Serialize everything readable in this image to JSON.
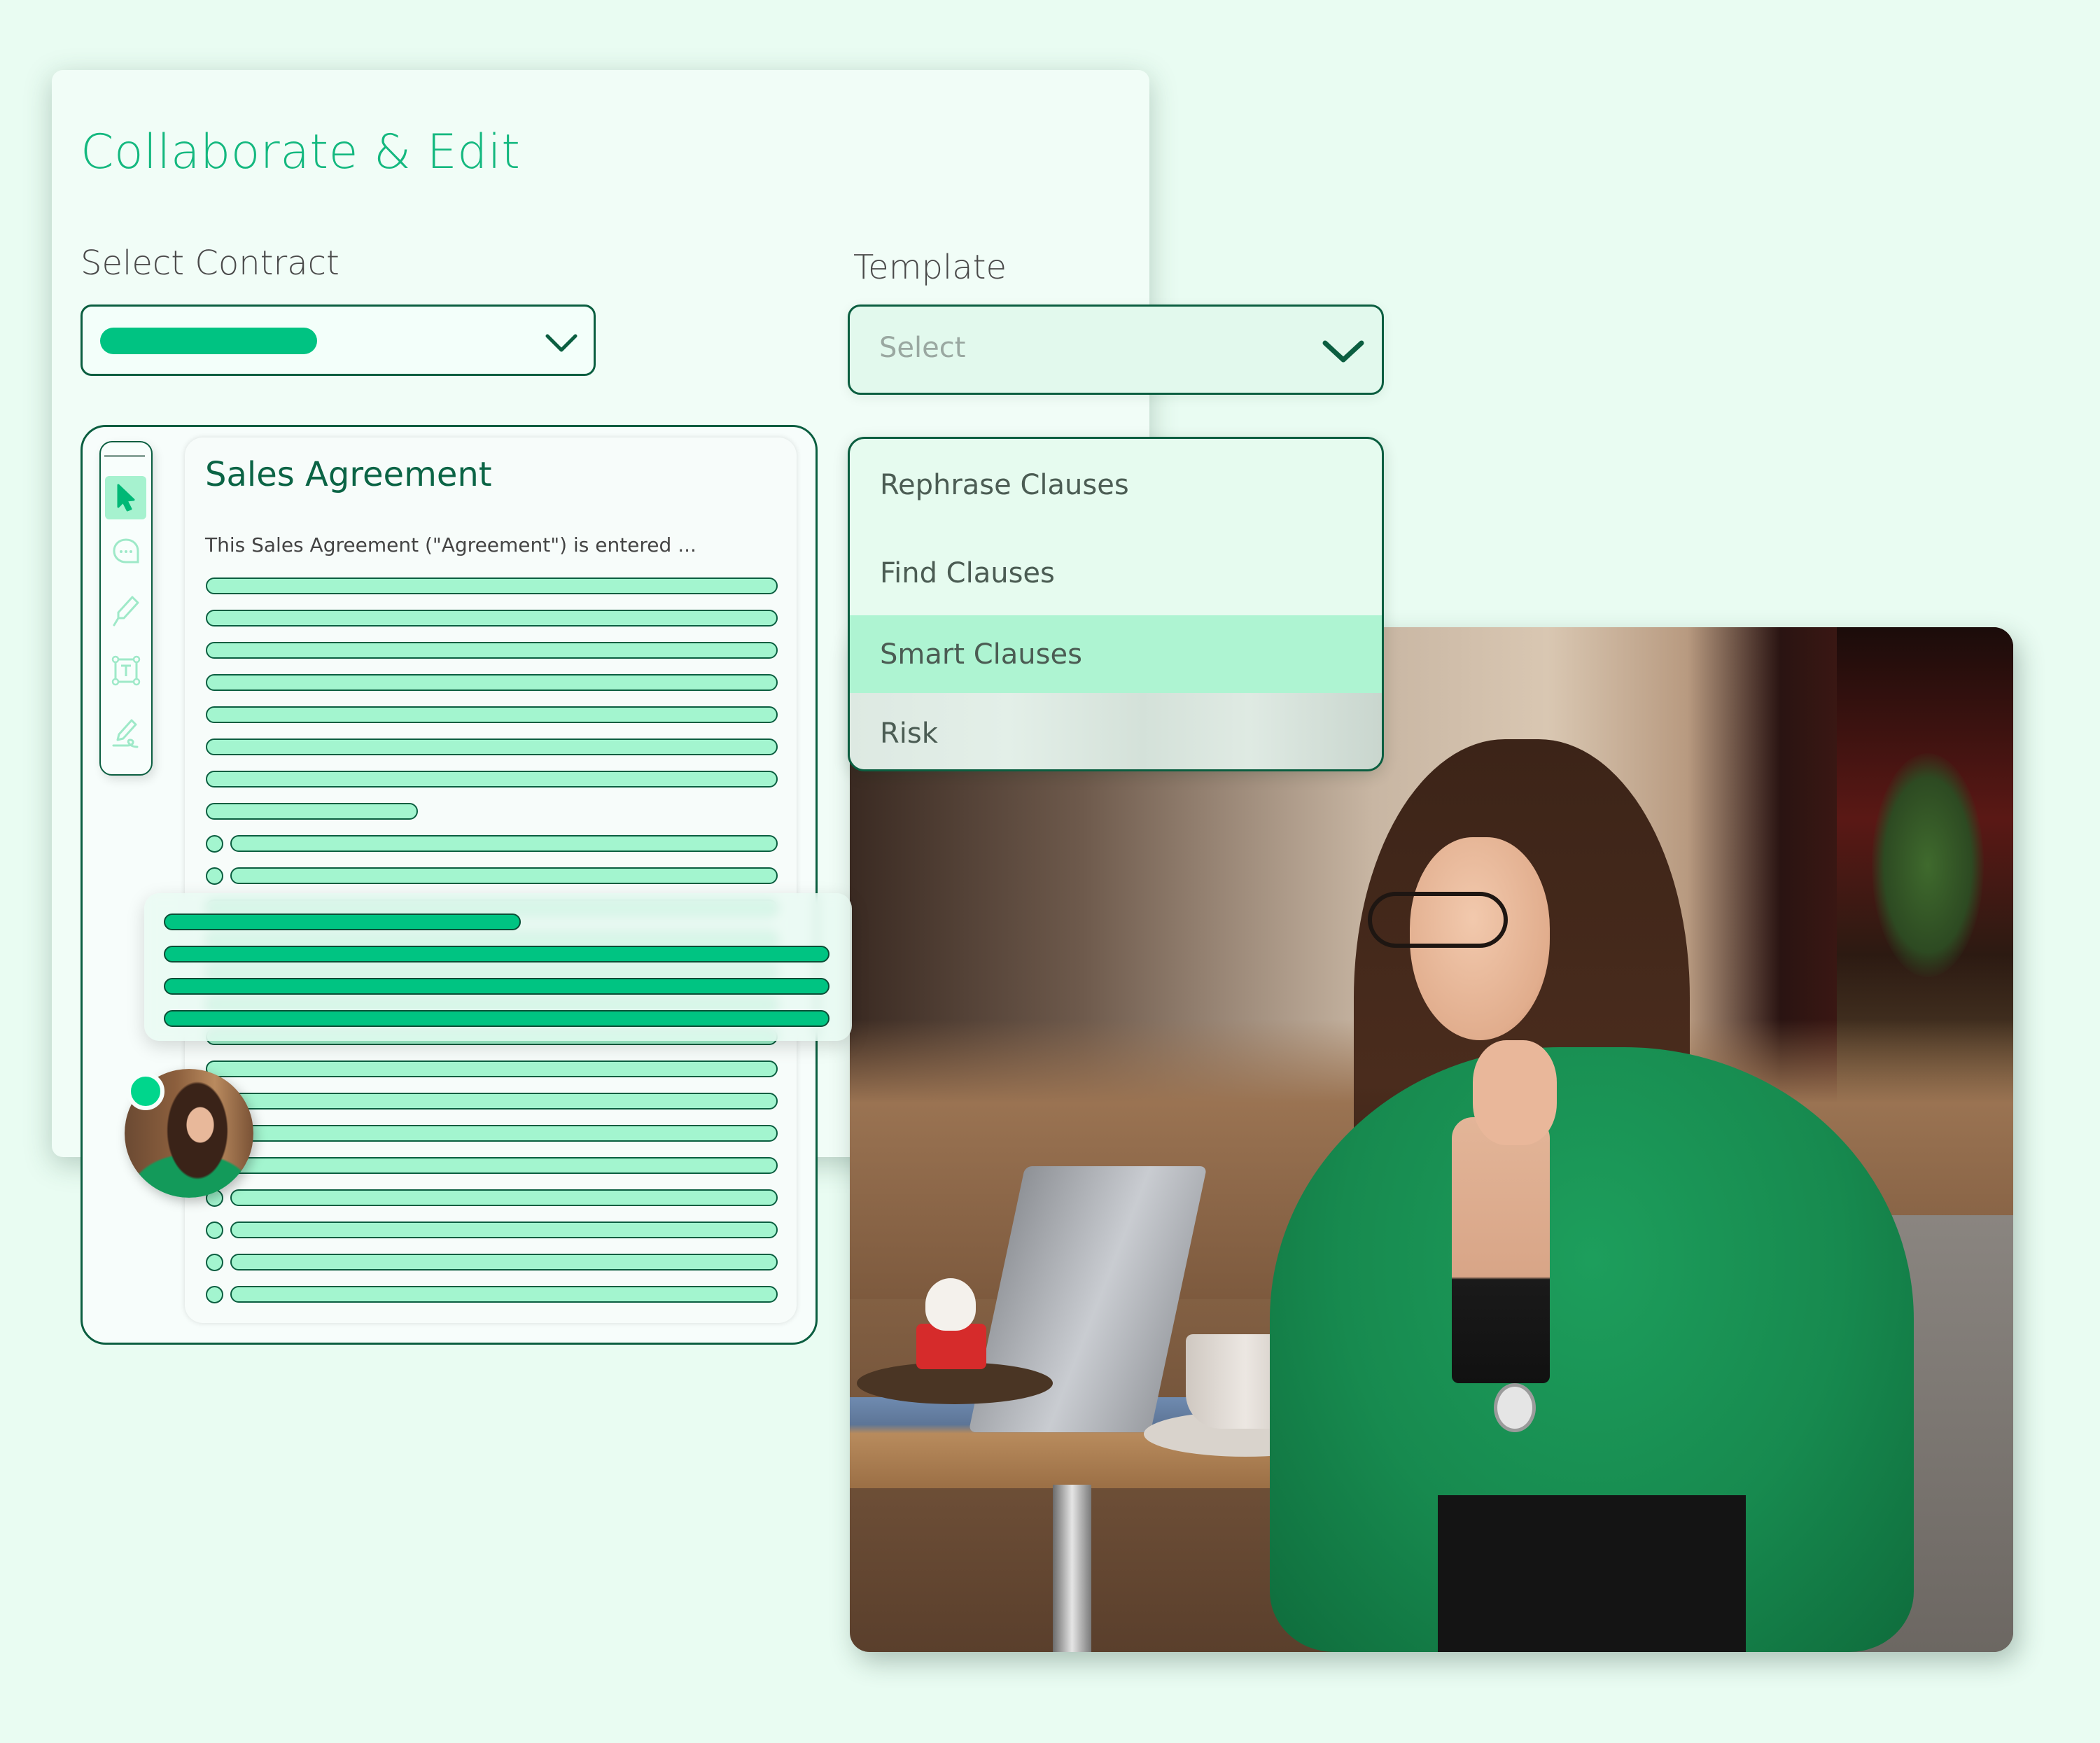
{
  "header": {
    "title": "Collaborate & Edit"
  },
  "contract": {
    "label": "Select Contract",
    "selected_value_redacted": true,
    "chevron_icon": "chevron-down-icon"
  },
  "template": {
    "label": "Template",
    "placeholder": "Select",
    "chevron_icon": "chevron-down-icon",
    "options": [
      {
        "label": "Rephrase Clauses",
        "selected": false
      },
      {
        "label": "Find Clauses",
        "selected": false
      },
      {
        "label": "Smart Clauses",
        "selected": true
      },
      {
        "label": "Risk",
        "selected": false
      }
    ]
  },
  "toolbar": {
    "tools": [
      {
        "name": "cursor",
        "icon": "cursor-icon",
        "active": true
      },
      {
        "name": "comment",
        "icon": "comment-icon",
        "active": false
      },
      {
        "name": "highlight",
        "icon": "highlighter-icon",
        "active": false
      },
      {
        "name": "text-box",
        "icon": "text-box-icon",
        "active": false
      },
      {
        "name": "signature",
        "icon": "signature-icon",
        "active": false
      }
    ]
  },
  "document": {
    "title": "Sales Agreement",
    "intro": "This Sales Agreement (\"Agreement\") is entered ..."
  },
  "collaborator": {
    "status": "online"
  },
  "colors": {
    "accent": "#14b87f",
    "dark_green": "#0b5e40",
    "line_fill": "#a3f5cf",
    "highlight_fill": "#00c482",
    "selected_option": "#aef4d2",
    "background": "#e9fcf2"
  }
}
